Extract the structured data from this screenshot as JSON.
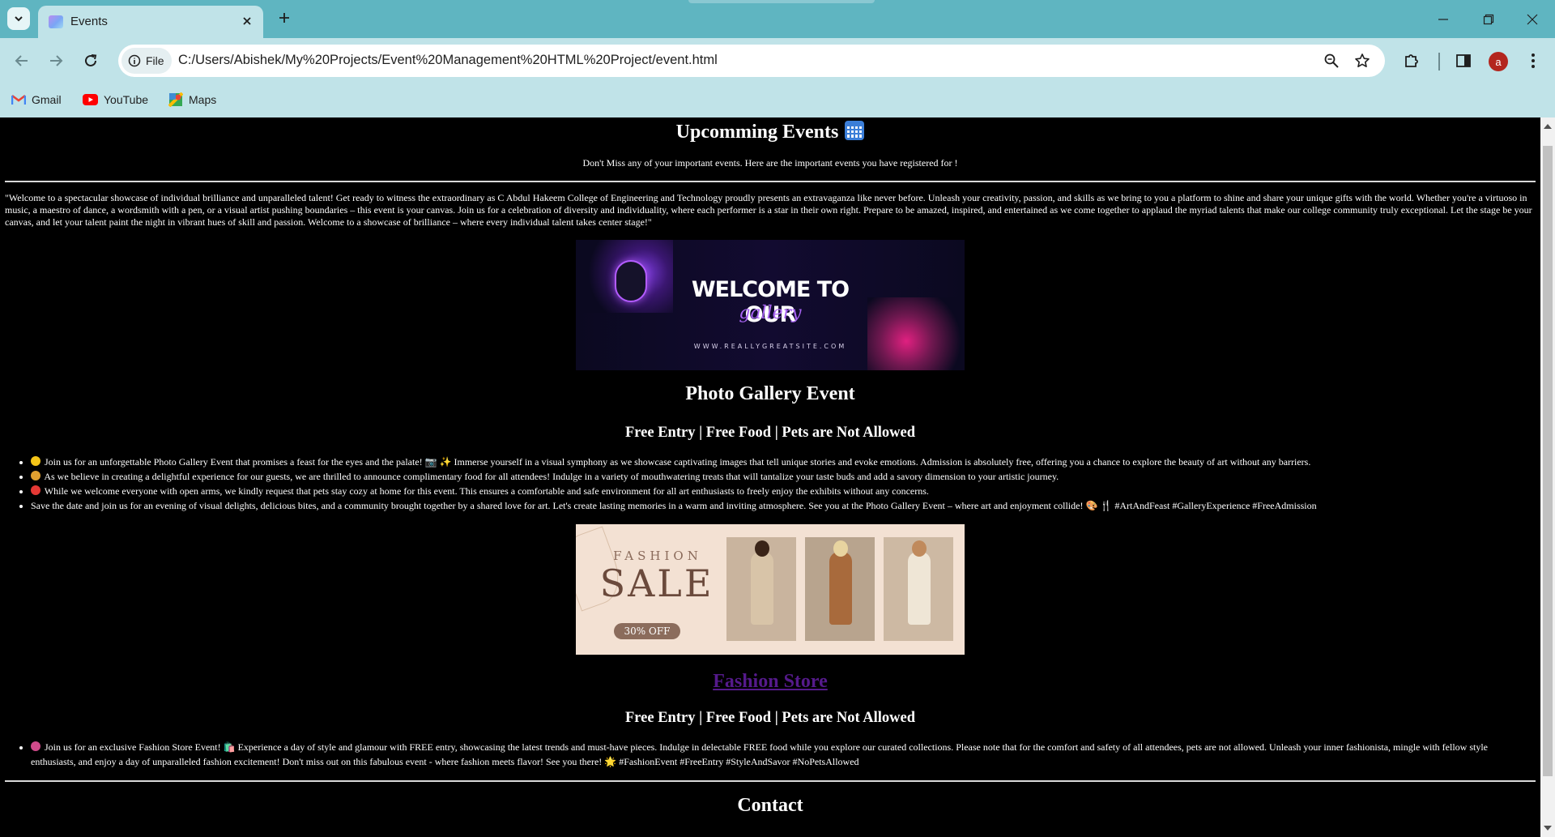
{
  "browser": {
    "tab_title": "Events",
    "site_chip_label": "File",
    "url": "C:/Users/Abishek/My%20Projects/Event%20Management%20HTML%20Project/event.html",
    "avatar_letter": "a",
    "bookmarks": [
      {
        "label": "Gmail",
        "icon": "gmail-icon"
      },
      {
        "label": "YouTube",
        "icon": "youtube-icon"
      },
      {
        "label": "Maps",
        "icon": "maps-icon"
      }
    ]
  },
  "page": {
    "title": "Upcomming Events",
    "title_icon": "calendar-icon",
    "subtitle": "Don't Miss any of your important events. Here are the important events you have registered for !",
    "intro": "\"Welcome to a spectacular showcase of individual brilliance and unparalleled talent! Get ready to witness the extraordinary as C Abdul Hakeem College of Engineering and Technology proudly presents an extravaganza like never before. Unleash your creativity, passion, and skills as we bring to you a platform to shine and share your unique gifts with the world. Whether you're a virtuoso in music, a maestro of dance, a wordsmith with a pen, or a visual artist pushing boundaries – this event is your canvas. Join us for a celebration of diversity and individuality, where each performer is a star in their own right. Prepare to be amazed, inspired, and entertained as we come together to applaud the myriad talents that make our college community truly exceptional. Let the stage be your canvas, and let your talent paint the night in vibrant hues of skill and passion. Welcome to a showcase of brilliance – where every individual talent takes center stage!\"",
    "banner1": {
      "title": "WELCOME TO OUR",
      "script": "gallery",
      "url": "WWW.REALLYGREATSITE.COM"
    },
    "event1": {
      "title": "Photo Gallery Event",
      "subtitle": "Free Entry | Free Food | Pets are Not Allowed",
      "items": [
        {
          "emoji_color": "#f5c518",
          "text": "Join us for an unforgettable Photo Gallery Event that promises a feast for the eyes and the palate! 📷 ✨ Immerse yourself in a visual symphony as we showcase captivating images that tell unique stories and evoke emotions. Admission is absolutely free, offering you a chance to explore the beauty of art without any barriers."
        },
        {
          "emoji_color": "#e0a030",
          "text": "As we believe in creating a delightful experience for our guests, we are thrilled to announce complimentary food for all attendees! Indulge in a variety of mouthwatering treats that will tantalize your taste buds and add a savory dimension to your artistic journey."
        },
        {
          "emoji_color": "#e53935",
          "text": "While we welcome everyone with open arms, we kindly request that pets stay cozy at home for this event. This ensures a comfortable and safe environment for all art enthusiasts to freely enjoy the exhibits without any concerns."
        },
        {
          "emoji_color": "",
          "text": "Save the date and join us for an evening of visual delights, delicious bites, and a community brought together by a shared love for art. Let's create lasting memories in a warm and inviting atmosphere. See you at the Photo Gallery Event – where art and enjoyment collide! 🎨 🍴 #ArtAndFeast #GalleryExperience #FreeAdmission"
        }
      ]
    },
    "banner2": {
      "fashion": "FASHION",
      "sale": "SALE",
      "off": "30% OFF"
    },
    "event2": {
      "title": "Fashion Store",
      "subtitle": "Free Entry | Free Food | Pets are Not Allowed",
      "items": [
        {
          "emoji_color": "#d04a8a",
          "text": "Join us for an exclusive Fashion Store Event! 🛍️ Experience a day of style and glamour with FREE entry, showcasing the latest trends and must-have pieces. Indulge in delectable FREE food while you explore our curated collections. Please note that for the comfort and safety of all attendees, pets are not allowed. Unleash your inner fashionista, mingle with fellow style enthusiasts, and enjoy a day of unparalleled fashion excitement! Don't miss out on this fabulous event - where fashion meets flavor! See you there! 🌟 #FashionEvent #FreeEntry #StyleAndSavor #NoPetsAllowed"
        }
      ]
    },
    "contact_title": "Contact"
  }
}
